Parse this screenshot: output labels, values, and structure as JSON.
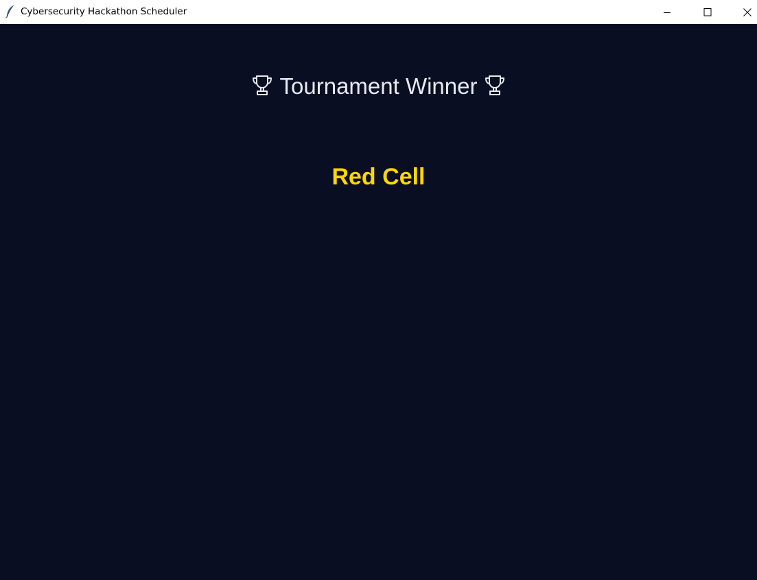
{
  "window": {
    "title": "Cybersecurity Hackathon Scheduler",
    "app_icon": "feather-icon",
    "controls": [
      "minimize-icon",
      "maximize-icon",
      "close-icon"
    ]
  },
  "main": {
    "heading": "Tournament Winner",
    "heading_icon": "trophy-icon",
    "winner_name": "Red Cell"
  },
  "colors": {
    "background": "#0a0e22",
    "heading_text": "#e8eaf2",
    "winner_text": "#ffd700",
    "titlebar": "#ffffff"
  }
}
